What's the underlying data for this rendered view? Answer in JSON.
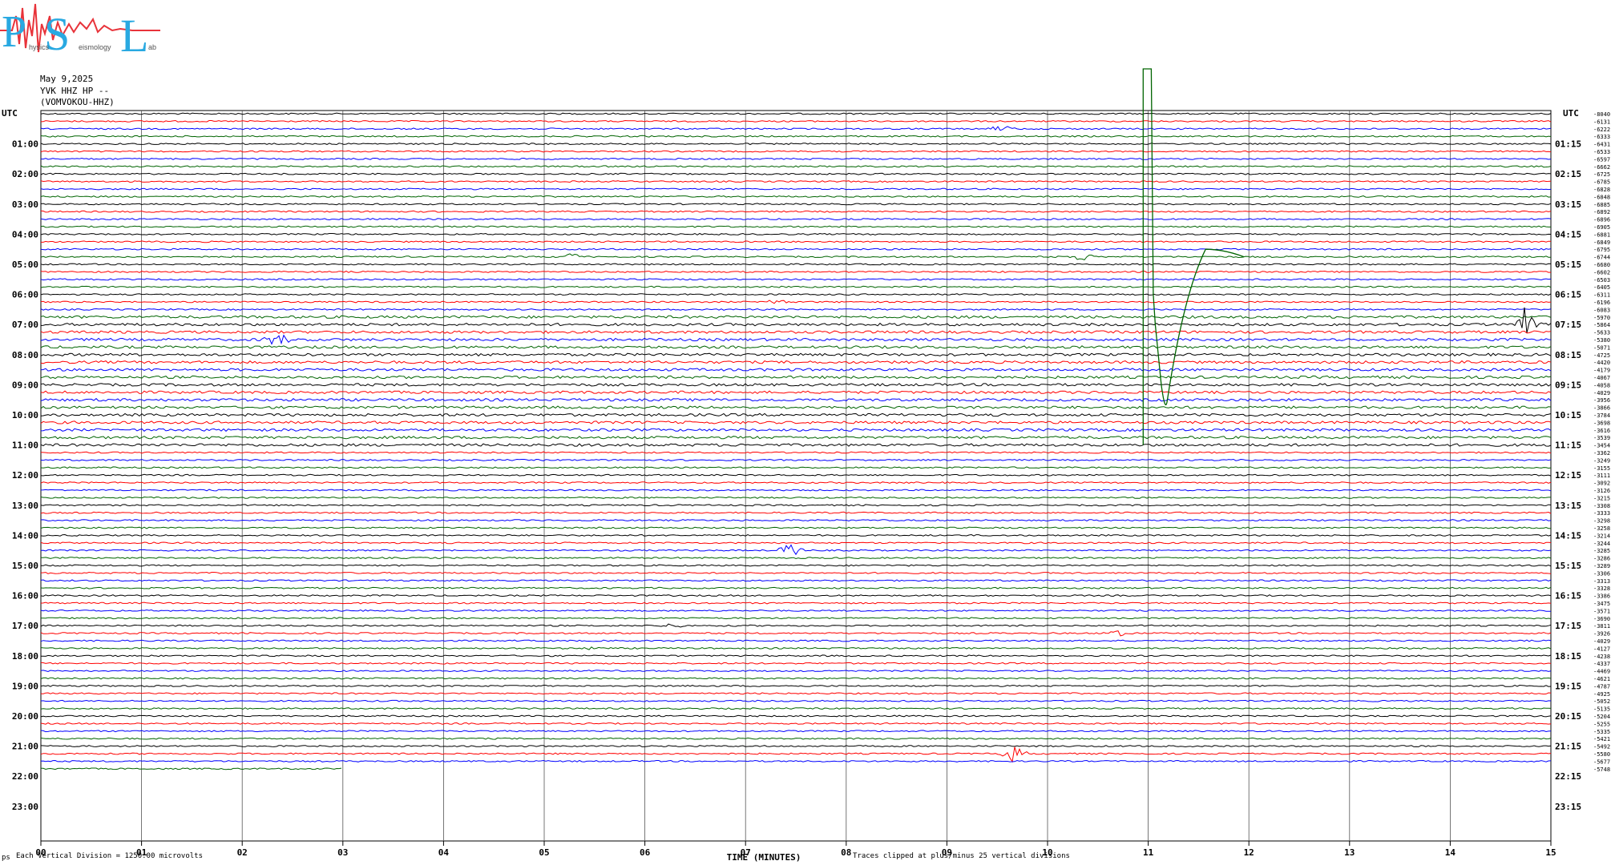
{
  "logo": {
    "letters": [
      "P",
      "S",
      "L"
    ],
    "small_words": [
      "hysics",
      "eismology",
      "ab"
    ],
    "colors": {
      "letters": "#29a9e1",
      "trace": "#e8333a"
    }
  },
  "header": {
    "date": "May 9,2025",
    "station": "YVK HHZ HP --",
    "location": "(VOMVOKOU-HHZ)"
  },
  "chart_data": {
    "type": "line",
    "title": "",
    "xlabel": "TIME (MINUTES)",
    "x_ticks": [
      "00",
      "01",
      "02",
      "03",
      "04",
      "05",
      "06",
      "07",
      "08",
      "09",
      "10",
      "11",
      "12",
      "13",
      "14",
      "15"
    ],
    "xlim": [
      0,
      15
    ],
    "left_corner_label": "UTC",
    "right_corner_label": "UTC",
    "left_hour_labels": [
      "01:00",
      "02:00",
      "03:00",
      "04:00",
      "05:00",
      "06:00",
      "07:00",
      "08:00",
      "09:00",
      "10:00",
      "11:00",
      "12:00",
      "13:00",
      "14:00",
      "15:00",
      "16:00",
      "17:00",
      "18:00",
      "19:00",
      "20:00",
      "21:00",
      "22:00",
      "23:00"
    ],
    "right_hour_labels": [
      "01:15",
      "02:15",
      "03:15",
      "04:15",
      "05:15",
      "06:15",
      "07:15",
      "08:15",
      "09:15",
      "10:15",
      "11:15",
      "12:15",
      "13:15",
      "14:15",
      "15:15",
      "16:15",
      "17:15",
      "18:15",
      "19:15",
      "20:15",
      "21:15",
      "22:15",
      "23:15"
    ],
    "rows_per_hour": 4,
    "total_rows": 96,
    "line_colors": [
      "#000000",
      "#ff0000",
      "#0000ff",
      "#006400"
    ],
    "trace_offsets": [
      "-8040",
      "-6131",
      "-6222",
      "-6333",
      "-6431",
      "-6533",
      "-6597",
      "-6662",
      "-6725",
      "-6785",
      "-6828",
      "-6848",
      "-6885",
      "-6892",
      "-6896",
      "-6905",
      "-6881",
      "-6849",
      "-6795",
      "-6744",
      "-6680",
      "-6602",
      "-6503",
      "-6405",
      "-6311",
      "-6196",
      "-6083",
      "-5970",
      "-5864",
      "-5633",
      "-5380",
      "-5071",
      "-4725",
      "-4420",
      "-4179",
      "-4067",
      "-4058",
      "-4029",
      "-3956",
      "-3866",
      "-3784",
      "-3698",
      "-3616",
      "-3539",
      "-3454",
      "-3362",
      "-3249",
      "-3155",
      "-3111",
      "-3092",
      "-3126",
      "-3215",
      "-3308",
      "-3333",
      "-3298",
      "-3258",
      "-3214",
      "-3244",
      "-3285",
      "-3286",
      "-3289",
      "-3306",
      "-3313",
      "-3328",
      "-3386",
      "-3475",
      "-3571",
      "-3690",
      "-3811",
      "-3926",
      "-4029",
      "-4127",
      "-4238",
      "-4337",
      "-4469",
      "-4621",
      "-4787",
      "-4925",
      "-5052",
      "-5135",
      "-5204",
      "-5255",
      "-5335",
      "-5421",
      "-5492",
      "-5580",
      "-5677",
      "-5748"
    ],
    "last_row_end_minute": 3.0,
    "events": [
      {
        "row": 2,
        "minute": 9.55,
        "amp": 4,
        "color": "#0000ff"
      },
      {
        "row": 19,
        "minute": 5.3,
        "amp": 5,
        "color": "#006400"
      },
      {
        "row": 19,
        "minute": 10.35,
        "amp": 6,
        "color": "#006400"
      },
      {
        "row": 25,
        "minute": 7.3,
        "amp": 3,
        "color": "#ff0000"
      },
      {
        "row": 28,
        "minute": 14.75,
        "amp": 22,
        "color": "#000000"
      },
      {
        "row": 30,
        "minute": 2.35,
        "amp": 9,
        "color": "#0000ff"
      },
      {
        "row": 58,
        "minute": 7.45,
        "amp": 9,
        "color": "#0000ff"
      },
      {
        "row": 68,
        "minute": 6.25,
        "amp": 3,
        "color": "#000000"
      },
      {
        "row": 69,
        "minute": 10.7,
        "amp": 4,
        "color": "#ff0000"
      },
      {
        "row": 71,
        "minute": 5.5,
        "amp": 3,
        "color": "#006400"
      },
      {
        "row": 85,
        "minute": 9.65,
        "amp": 10,
        "color": "#ff0000"
      }
    ],
    "clipped_transient": {
      "start_minute": 10.95,
      "color": "#006400",
      "note": "large clipped pulse near minute 11 spanning many traces"
    }
  },
  "footer": {
    "scale_note": "Each Vertical Division = 1250.00 microvolts",
    "clip_note": "Traces clipped at plus/minus 25 vertical divisions",
    "corner_mark": "ps"
  }
}
